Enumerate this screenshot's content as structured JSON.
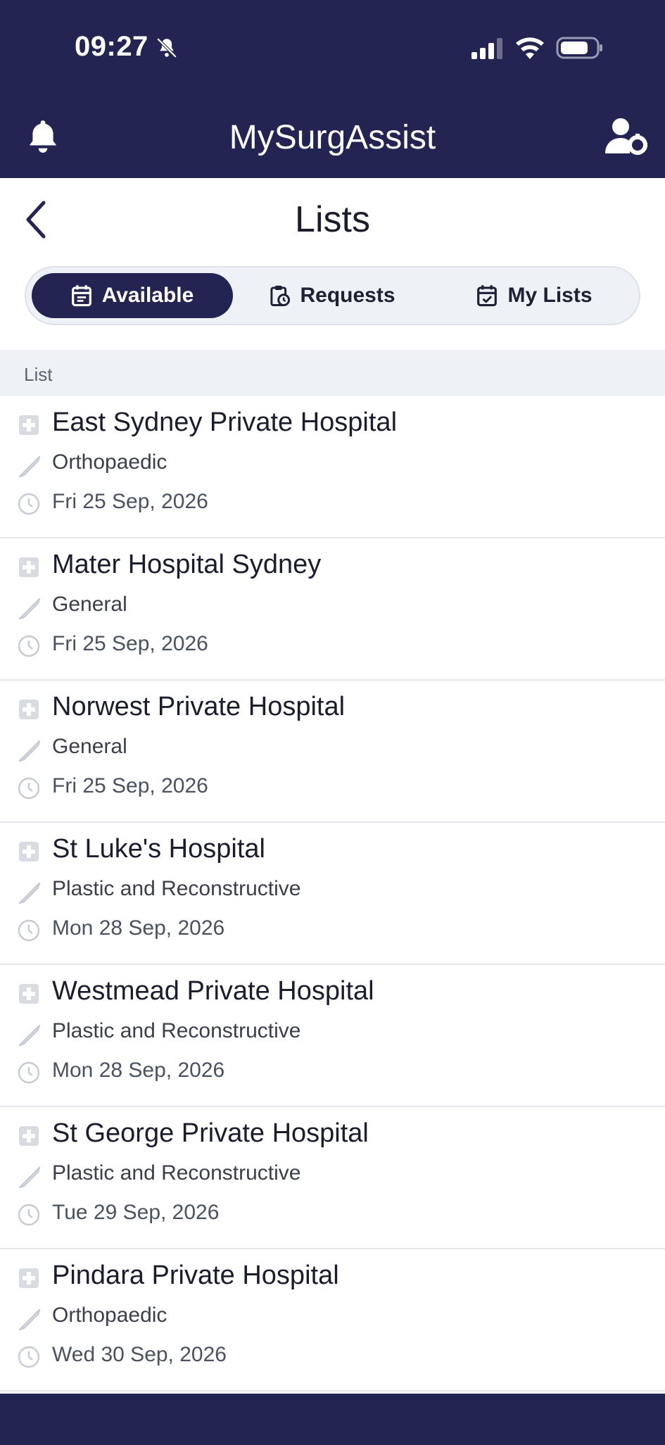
{
  "status_bar": {
    "time": "09:27"
  },
  "header": {
    "title": "MySurgAssist"
  },
  "page": {
    "title": "Lists"
  },
  "tabs": [
    {
      "label": "Available",
      "icon": "calendar-list-icon",
      "active": true
    },
    {
      "label": "Requests",
      "icon": "clipboard-clock-icon",
      "active": false
    },
    {
      "label": "My Lists",
      "icon": "calendar-check-icon",
      "active": false
    }
  ],
  "section": {
    "label": "List"
  },
  "items": [
    {
      "hospital": "East Sydney Private Hospital",
      "specialty": "Orthopaedic",
      "date": "Fri 25 Sep, 2026"
    },
    {
      "hospital": "Mater Hospital Sydney",
      "specialty": "General",
      "date": "Fri 25 Sep, 2026"
    },
    {
      "hospital": "Norwest Private Hospital",
      "specialty": "General",
      "date": "Fri 25 Sep, 2026"
    },
    {
      "hospital": "St Luke's Hospital",
      "specialty": "Plastic and Reconstructive",
      "date": "Mon 28 Sep, 2026"
    },
    {
      "hospital": "Westmead Private Hospital",
      "specialty": "Plastic and Reconstructive",
      "date": "Mon 28 Sep, 2026"
    },
    {
      "hospital": "St George Private Hospital",
      "specialty": "Plastic and Reconstructive",
      "date": "Tue 29 Sep, 2026"
    },
    {
      "hospital": "Pindara Private Hospital",
      "specialty": "Orthopaedic",
      "date": "Wed 30 Sep, 2026"
    }
  ],
  "colors": {
    "brand_navy": "#232452",
    "section_bg": "#eef1f6",
    "divider": "#e4e7ec"
  }
}
